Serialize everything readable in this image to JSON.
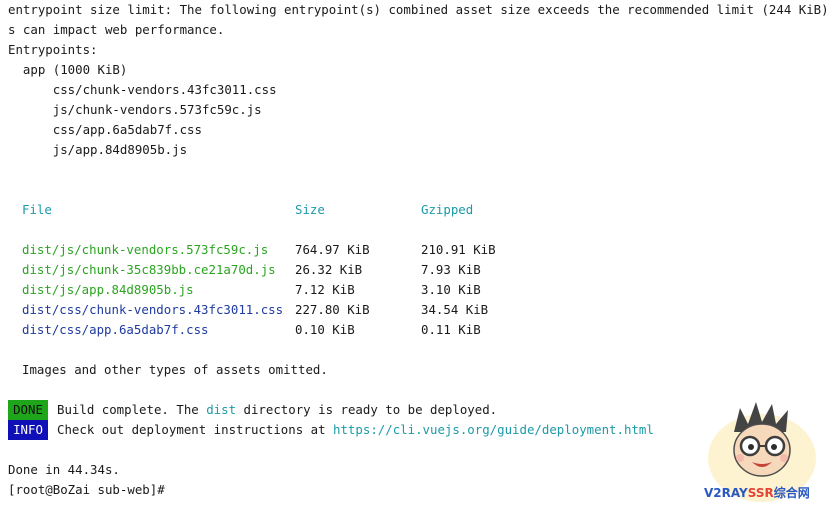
{
  "warning": {
    "line1": "entrypoint size limit: The following entrypoint(s) combined asset size exceeds the recommended limit (244 KiB). Thi",
    "line2": "s can impact web performance.",
    "entrypoints_label": "Entrypoints:",
    "app_label": "  app (1000 KiB)",
    "files": [
      "      css/chunk-vendors.43fc3011.css",
      "      js/chunk-vendors.573fc59c.js",
      "      css/app.6a5dab7f.css",
      "      js/app.84d8905b.js"
    ]
  },
  "table": {
    "headers": {
      "file": "File",
      "size": "Size",
      "gzipped": "Gzipped"
    },
    "rows": [
      {
        "file": "dist/js/chunk-vendors.573fc59c.js",
        "size": "764.97 KiB",
        "gzipped": "210.91 KiB",
        "kind": "js"
      },
      {
        "file": "dist/js/chunk-35c839bb.ce21a70d.js",
        "size": "26.32 KiB",
        "gzipped": "7.93 KiB",
        "kind": "js"
      },
      {
        "file": "dist/js/app.84d8905b.js",
        "size": "7.12 KiB",
        "gzipped": "3.10 KiB",
        "kind": "js"
      },
      {
        "file": "dist/css/chunk-vendors.43fc3011.css",
        "size": "227.80 KiB",
        "gzipped": "34.54 KiB",
        "kind": "css"
      },
      {
        "file": "dist/css/app.6a5dab7f.css",
        "size": "0.10 KiB",
        "gzipped": "0.11 KiB",
        "kind": "css"
      }
    ]
  },
  "omitted": "Images and other types of assets omitted.",
  "done": {
    "badge": "DONE",
    "text_before": "Build complete. The ",
    "dir": "dist",
    "text_after": " directory is ready to be deployed."
  },
  "info": {
    "badge": "INFO",
    "text": "Check out deployment instructions at ",
    "url": "https://cli.vuejs.org/guide/deployment.html"
  },
  "done_time": "Done in 44.34s.",
  "prompt": "[root@BoZai sub-web]#",
  "watermark": {
    "brand_a": "V2RAY",
    "brand_b": "SSR",
    "brand_c": "综合网"
  },
  "colors": {
    "cyan": "#1c9aa8",
    "green": "#2aa520",
    "blue": "#1f3aa0",
    "done_bg": "#1ea51a",
    "info_bg": "#1010b8"
  }
}
